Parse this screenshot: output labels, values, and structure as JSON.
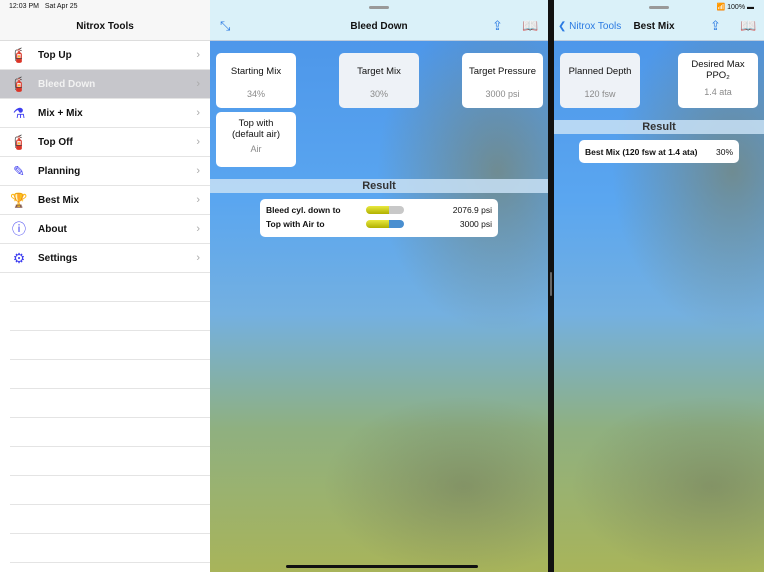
{
  "status_bar": {
    "time": "12:03 PM",
    "date": "Sat Apr 25",
    "battery": "100%"
  },
  "sidebar": {
    "title": "Nitrox Tools",
    "selected": "Bleed Down",
    "items": [
      {
        "label": "Top Up",
        "icon": "cylinder-top-up-icon"
      },
      {
        "label": "Bleed Down",
        "icon": "cylinder-bleed-icon"
      },
      {
        "label": "Mix + Mix",
        "icon": "twin-cylinders-icon"
      },
      {
        "label": "Top Off",
        "icon": "cylinder-top-off-icon"
      },
      {
        "label": "Planning",
        "icon": "notepad-pencil-icon"
      },
      {
        "label": "Best Mix",
        "icon": "trophy-icon"
      },
      {
        "label": "About",
        "icon": "info-icon"
      },
      {
        "label": "Settings",
        "icon": "gear-icon"
      }
    ]
  },
  "bleed": {
    "title": "Bleed Down",
    "starting_mix": {
      "label": "Starting Mix",
      "value": "34%"
    },
    "target_mix": {
      "label": "Target Mix",
      "value": "30%"
    },
    "target_pressure": {
      "label": "Target Pressure",
      "value": "3000 psi"
    },
    "top_with": {
      "label_1": "Top with",
      "label_2": "(default air)",
      "value": "Air"
    },
    "result_title": "Result",
    "results": [
      {
        "label": "Bleed cyl. down to",
        "value": "2076.9 psi",
        "fill": 0.6,
        "rest_color": "#c8c8c8"
      },
      {
        "label": "Top with Air to",
        "value": "3000 psi",
        "fill": 0.6,
        "rest_color": "#4a8fd0"
      }
    ]
  },
  "best_mix": {
    "back_label": "Nitrox Tools",
    "title": "Best Mix",
    "planned_depth": {
      "label": "Planned Depth",
      "value": "120 fsw"
    },
    "max_ppo2": {
      "label_1": "Desired Max",
      "label_2": "PPO₂",
      "value": "1.4 ata"
    },
    "result_title": "Result",
    "result": {
      "label": "Best Mix (120 fsw at 1.4 ata)",
      "value": "30%"
    }
  }
}
